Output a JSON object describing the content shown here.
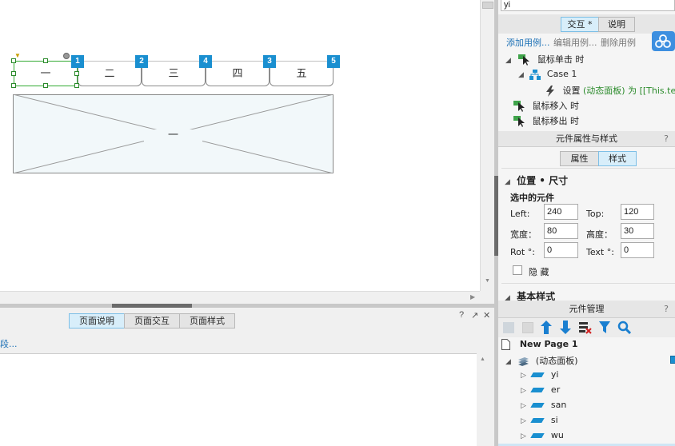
{
  "canvas": {
    "tabs": [
      {
        "label": "一",
        "badge": "1"
      },
      {
        "label": "二",
        "badge": "2"
      },
      {
        "label": "三",
        "badge": "4"
      },
      {
        "label": "四",
        "badge": "3"
      },
      {
        "label": "五",
        "badge": "5"
      }
    ],
    "panel_label": "一"
  },
  "notes": {
    "tabs": [
      "页面说明",
      "页面交互",
      "页面样式"
    ],
    "link": "段...",
    "controls": [
      "?",
      "↗",
      "✕"
    ]
  },
  "interactions": {
    "name_field": "yi",
    "tabs": [
      "交互 *",
      "说明"
    ],
    "actions": [
      "添加用例...",
      "编辑用例...",
      "删除用例"
    ],
    "tree": {
      "click": "鼠标单击 时",
      "case": "Case 1",
      "action_prefix": "设置",
      "action_text": "(动态面板) 为 [[This.text]]",
      "mouse_in": "鼠标移入 时",
      "mouse_out": "鼠标移出 时"
    }
  },
  "properties": {
    "header": "元件属性与样式",
    "help": "?",
    "tabs": [
      "属性",
      "样式"
    ],
    "section": "位置 • 尺寸",
    "subsection": "选中的元件",
    "left_label": "Left:",
    "left_value": "240",
    "top_label": "Top:",
    "top_value": "120",
    "width_label": "宽度：",
    "width_value": "80",
    "height_label": "高度：",
    "height_value": "30",
    "rot_label": "Rot °:",
    "rot_value": "0",
    "text_label": "Text °:",
    "text_value": "0",
    "hidden_label": "隐 藏",
    "basic_style": "基本样式"
  },
  "outline": {
    "header": "元件管理",
    "help": "?",
    "page": "New Page 1",
    "panel": "(动态面板)",
    "states": [
      "yi",
      "er",
      "san",
      "si",
      "wu"
    ]
  },
  "colors": {
    "accent": "#1a8fd0",
    "selection": "#33aa33",
    "tab_active": "#d8eefa",
    "link": "#1a6fb5",
    "green_text": "#2a8a2a"
  }
}
